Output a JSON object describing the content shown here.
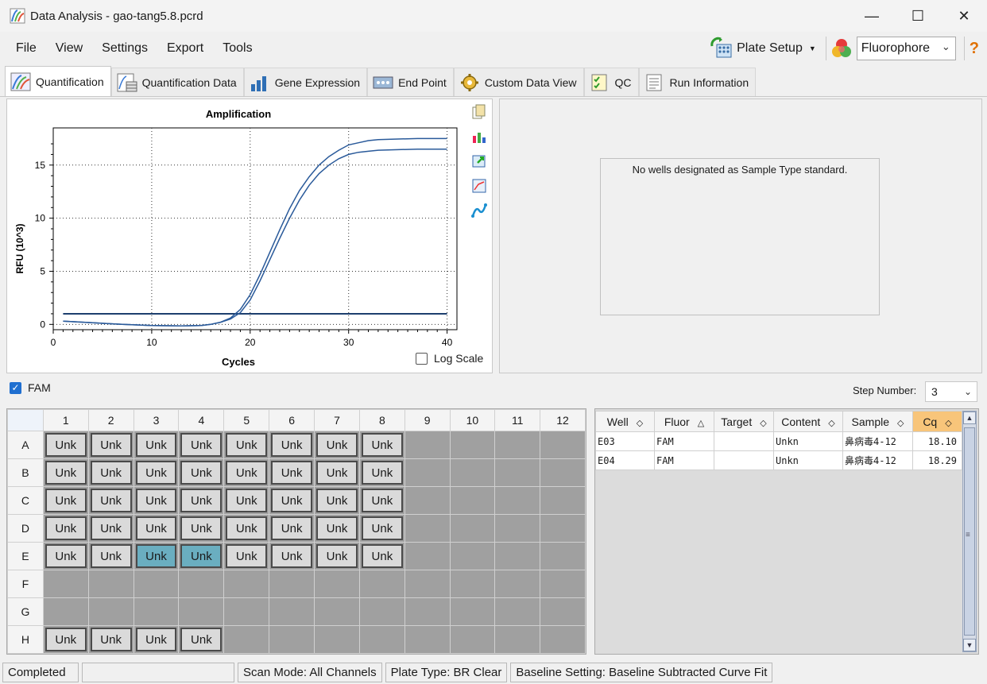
{
  "window": {
    "title": "Data Analysis - gao-tang5.8.pcrd"
  },
  "menu": {
    "items": [
      "File",
      "View",
      "Settings",
      "Export",
      "Tools"
    ]
  },
  "toolbar": {
    "plate_setup": "Plate Setup",
    "fluorophore": "Fluorophore",
    "help": "?"
  },
  "tabs": [
    {
      "label": "Quantification",
      "icon": "amplification-icon"
    },
    {
      "label": "Quantification Data",
      "icon": "data-sheet-icon"
    },
    {
      "label": "Gene Expression",
      "icon": "bar-chart-icon"
    },
    {
      "label": "End Point",
      "icon": "endpoint-icon"
    },
    {
      "label": "Custom Data View",
      "icon": "gear-icon"
    },
    {
      "label": "QC",
      "icon": "checklist-icon"
    },
    {
      "label": "Run Information",
      "icon": "document-icon"
    }
  ],
  "chart_data": {
    "type": "line",
    "title": "Amplification",
    "xlabel": "Cycles",
    "ylabel": "RFU (10^3)",
    "xlim": [
      0,
      41
    ],
    "ylim": [
      -0.5,
      18.5
    ],
    "xticks": [
      0,
      10,
      20,
      30,
      40
    ],
    "yticks": [
      0,
      5,
      10,
      15
    ],
    "grid": true,
    "threshold": 1.0,
    "series": [
      {
        "x": [
          1,
          4,
          7,
          10,
          13,
          15,
          16,
          17,
          18,
          19,
          20,
          21,
          22,
          23,
          24,
          25,
          26,
          27,
          28,
          29,
          30,
          31,
          32,
          33,
          35,
          37,
          40
        ],
        "y": [
          0.3,
          0.15,
          0.0,
          -0.1,
          -0.15,
          -0.1,
          0,
          0.2,
          0.6,
          1.4,
          2.8,
          4.7,
          6.8,
          8.9,
          10.9,
          12.6,
          13.9,
          15.0,
          15.8,
          16.4,
          16.9,
          17.1,
          17.3,
          17.4,
          17.45,
          17.5,
          17.5
        ]
      },
      {
        "x": [
          1,
          4,
          7,
          10,
          13,
          15,
          16,
          17,
          18,
          19,
          20,
          21,
          22,
          23,
          24,
          25,
          26,
          27,
          28,
          29,
          30,
          31,
          32,
          33,
          35,
          37,
          40
        ],
        "y": [
          0.3,
          0.15,
          0.0,
          -0.1,
          -0.15,
          -0.1,
          0,
          0.2,
          0.5,
          1.1,
          2.3,
          4.1,
          6.1,
          8.1,
          10.0,
          11.7,
          13.1,
          14.2,
          15.0,
          15.6,
          16.0,
          16.2,
          16.3,
          16.4,
          16.45,
          16.5,
          16.5
        ]
      }
    ]
  },
  "chart_ui": {
    "log_scale": "Log Scale"
  },
  "standards": {
    "message": "No wells designated as Sample Type standard."
  },
  "fam": {
    "label": "FAM",
    "checked": true
  },
  "step": {
    "label": "Step Number:",
    "value": "3"
  },
  "plate": {
    "columns": [
      "1",
      "2",
      "3",
      "4",
      "5",
      "6",
      "7",
      "8",
      "9",
      "10",
      "11",
      "12"
    ],
    "rows": [
      {
        "label": "A",
        "wells": [
          "Unk",
          "Unk",
          "Unk",
          "Unk",
          "Unk",
          "Unk",
          "Unk",
          "Unk",
          "",
          "",
          "",
          ""
        ]
      },
      {
        "label": "B",
        "wells": [
          "Unk",
          "Unk",
          "Unk",
          "Unk",
          "Unk",
          "Unk",
          "Unk",
          "Unk",
          "",
          "",
          "",
          ""
        ]
      },
      {
        "label": "C",
        "wells": [
          "Unk",
          "Unk",
          "Unk",
          "Unk",
          "Unk",
          "Unk",
          "Unk",
          "Unk",
          "",
          "",
          "",
          ""
        ]
      },
      {
        "label": "D",
        "wells": [
          "Unk",
          "Unk",
          "Unk",
          "Unk",
          "Unk",
          "Unk",
          "Unk",
          "Unk",
          "",
          "",
          "",
          ""
        ]
      },
      {
        "label": "E",
        "wells": [
          "Unk",
          "Unk",
          "Unk",
          "Unk",
          "Unk",
          "Unk",
          "Unk",
          "Unk",
          "",
          "",
          "",
          ""
        ],
        "selected": [
          2,
          3
        ]
      },
      {
        "label": "F",
        "wells": [
          "",
          "",
          "",
          "",
          "",
          "",
          "",
          "",
          "",
          "",
          "",
          ""
        ]
      },
      {
        "label": "G",
        "wells": [
          "",
          "",
          "",
          "",
          "",
          "",
          "",
          "",
          "",
          "",
          "",
          ""
        ]
      },
      {
        "label": "H",
        "wells": [
          "Unk",
          "Unk",
          "Unk",
          "Unk",
          "",
          "",
          "",
          "",
          "",
          "",
          "",
          ""
        ]
      }
    ]
  },
  "results": {
    "headers": [
      "Well",
      "Fluor",
      "Target",
      "Content",
      "Sample",
      "Cq"
    ],
    "rows": [
      [
        "E03",
        "FAM",
        "",
        "Unkn",
        "鼻病毒4-12",
        "18.10"
      ],
      [
        "E04",
        "FAM",
        "",
        "Unkn",
        "鼻病毒4-12",
        "18.29"
      ]
    ]
  },
  "status": {
    "state": "Completed",
    "scan_mode": "Scan Mode: All Channels",
    "plate_type": "Plate Type: BR Clear",
    "baseline": "Baseline Setting: Baseline Subtracted Curve Fit"
  }
}
